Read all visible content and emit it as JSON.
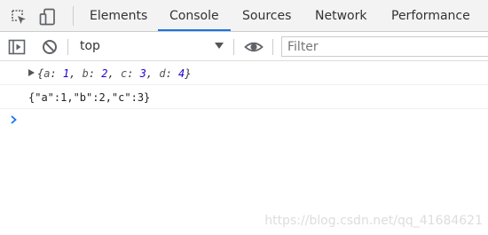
{
  "devtools": {
    "tabs": [
      "Elements",
      "Console",
      "Sources",
      "Network",
      "Performance"
    ],
    "active_tab": "Console"
  },
  "toolbar": {
    "context": "top",
    "filter_placeholder": "Filter"
  },
  "console": {
    "object_preview": {
      "open": "{",
      "close": "}",
      "entries": [
        {
          "key": "a",
          "value": "1"
        },
        {
          "key": "b",
          "value": "2"
        },
        {
          "key": "c",
          "value": "3"
        },
        {
          "key": "d",
          "value": "4"
        }
      ]
    },
    "json_output": "{\"a\":1,\"b\":2,\"c\":3}"
  },
  "watermark": "https://blog.csdn.net/qq_41684621",
  "colors": {
    "accent": "#1a73e8",
    "number_value": "#1c00cf",
    "prompt": "#1a73e8"
  },
  "icons": [
    "inspect-element-icon",
    "device-toolbar-icon",
    "show-sidebar-icon",
    "clear-console-icon",
    "chevron-down-icon",
    "live-expression-eye-icon",
    "expand-triangle-icon",
    "console-prompt-icon"
  ]
}
